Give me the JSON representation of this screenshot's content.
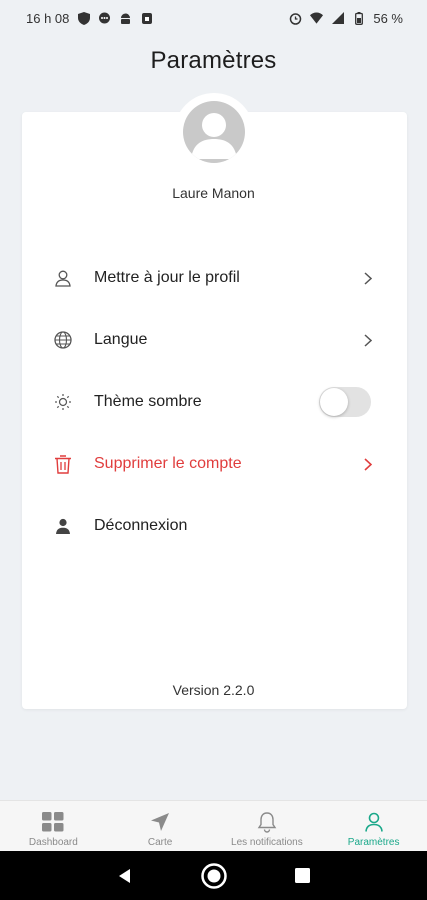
{
  "status_bar": {
    "time": "16 h 08",
    "battery": "56 %"
  },
  "page": {
    "title": "Paramètres"
  },
  "profile": {
    "name": "Laure Manon"
  },
  "menu": [
    {
      "label": "Mettre à jour le profil",
      "icon": "user-outline-icon",
      "has_chevron": true
    },
    {
      "label": "Langue",
      "icon": "globe-icon",
      "has_chevron": true
    },
    {
      "label": "Thème sombre",
      "icon": "sun-icon",
      "toggle_on": false
    },
    {
      "label": "Supprimer le compte",
      "icon": "trash-icon",
      "has_chevron": true,
      "color": "#e03d3d"
    },
    {
      "label": "Déconnexion",
      "icon": "user-filled-icon",
      "has_chevron": false
    }
  ],
  "version": "Version 2.2.0",
  "bottom_nav": [
    {
      "label": "Dashboard",
      "icon": "grid-icon",
      "active": false
    },
    {
      "label": "Carte",
      "icon": "navigation-arrow-icon",
      "active": false
    },
    {
      "label": "Les notifications",
      "icon": "bell-icon",
      "active": false
    },
    {
      "label": "Paramètres",
      "icon": "user-icon",
      "active": true
    }
  ],
  "colors": {
    "accent": "#1aa88a",
    "danger": "#e03d3d",
    "background": "#eef1f4"
  }
}
